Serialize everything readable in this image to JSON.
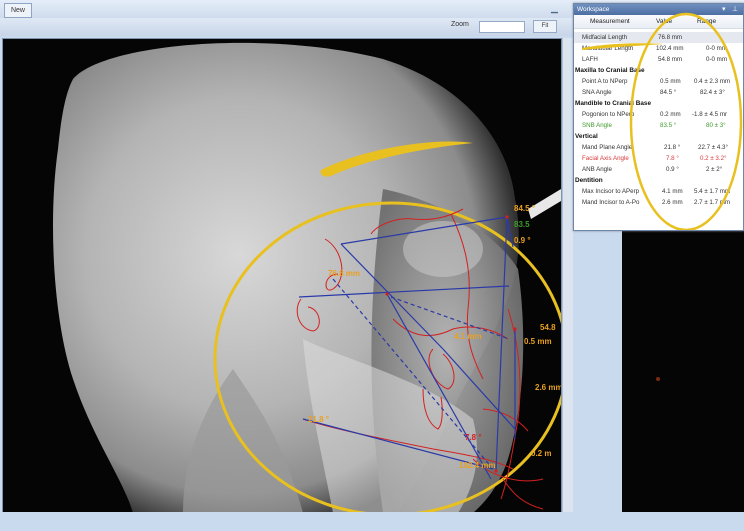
{
  "window": {
    "tab_label": "New",
    "zoom_label": "Zoom",
    "fit_label": "Fit"
  },
  "workspace": {
    "title": "Workspace",
    "headers": {
      "measurement": "Measurement",
      "value": "Value",
      "range": "Range"
    },
    "rows": [
      {
        "name": "Midfacial Length",
        "value": "76.8 mm",
        "range": ""
      },
      {
        "name": "Mandibular Length",
        "value": "102.4 mm",
        "range": "0-0 mm"
      },
      {
        "name": "LAFH",
        "value": "54.8 mm",
        "range": "0-0 mm"
      }
    ],
    "sections": [
      {
        "title": "Maxilla to Cranial Base",
        "rows": [
          {
            "name": "Point A to NPerp",
            "value": "0.5 mm",
            "range": "0.4 ± 2.3 mm"
          },
          {
            "name": "SNA Angle",
            "value": "84.5 °",
            "range": "82.4 ± 3°"
          }
        ]
      },
      {
        "title": "Mandible to Cranial Base",
        "rows": [
          {
            "name": "Pogonion to NPerp",
            "value": "0.2 mm",
            "range": "-1.8 ± 4.5 mr"
          },
          {
            "name": "SNB Angle",
            "value": "83.5 °",
            "range": "80 ± 3°"
          }
        ]
      },
      {
        "title": "Vertical",
        "rows": [
          {
            "name": "Mand Plane Angle",
            "value": "21.8 °",
            "range": "22.7 ± 4.3°"
          },
          {
            "name": "Facial Axis Angle",
            "value": "7.8 °",
            "range": "0.2 ± 3.2°"
          },
          {
            "name": "ANB Angle",
            "value": "0.9 °",
            "range": "2 ± 2°"
          }
        ]
      },
      {
        "title": "Dentition",
        "rows": [
          {
            "name": "Max Incisor to APerp",
            "value": "4.1 mm",
            "range": "5.4 ± 1.7 mm"
          },
          {
            "name": "Mand Incisor to A-Po",
            "value": "2.6 mm",
            "range": "2.7 ± 1.7 mm"
          }
        ]
      }
    ]
  },
  "overlay_labels": {
    "sna": "84.5 °",
    "snb": "83.5",
    "anb": "0.9 °",
    "midfacial": "76.8 mm",
    "max_incisor": "4.1 mm",
    "lafh": "54.8",
    "point_a": "0.5 mm",
    "mand_incisor": "2.6 mm",
    "mand_plane": "21.8 °",
    "facial_axis": "7.8 °",
    "pogonion": "0.2 m",
    "mandibular_length": "102.4 mm"
  },
  "colors": {
    "annotation_yellow": "#e8c020",
    "measure_orange": "#e8a020",
    "tracing_red": "#d42020",
    "line_blue": "#2a3aa8",
    "value_green": "#3e9a2c",
    "value_red": "#d93a3a"
  }
}
